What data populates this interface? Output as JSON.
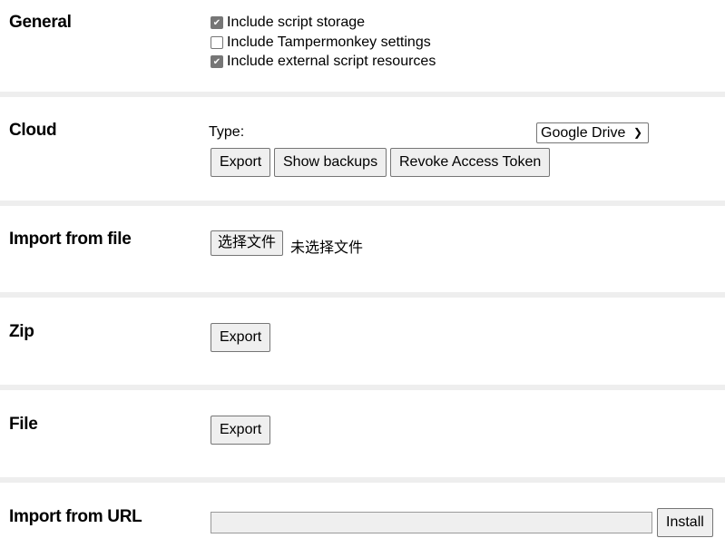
{
  "general": {
    "label": "General",
    "options": [
      {
        "label": "Include script storage",
        "checked": true
      },
      {
        "label": "Include Tampermonkey settings",
        "checked": false
      },
      {
        "label": "Include external script resources",
        "checked": true
      }
    ]
  },
  "cloud": {
    "label": "Cloud",
    "type_label": "Type:",
    "type_value": "Google Drive",
    "export": "Export",
    "show_backups": "Show backups",
    "revoke": "Revoke Access Token"
  },
  "import_file": {
    "label": "Import from file",
    "choose": "选择文件",
    "no_file": "未选择文件"
  },
  "zip": {
    "label": "Zip",
    "export": "Export"
  },
  "file": {
    "label": "File",
    "export": "Export"
  },
  "import_url": {
    "label": "Import from URL",
    "value": "",
    "install": "Install"
  }
}
